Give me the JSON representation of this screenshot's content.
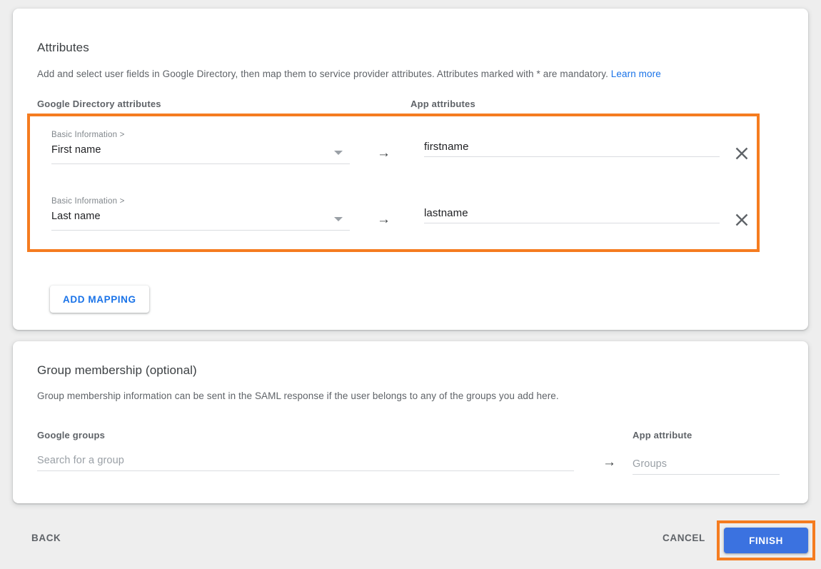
{
  "attributes_section": {
    "title": "Attributes",
    "description_before_link": "Add and select user fields in Google Directory, then map them to service provider attributes. Attributes marked with * are mandatory. ",
    "learn_more_label": "Learn more",
    "columns": {
      "google_directory": "Google Directory attributes",
      "app_attributes": "App attributes"
    },
    "mappings": [
      {
        "google_caption": "Basic Information >",
        "google_value": "First name",
        "arrow": "→",
        "app_value": "firstname",
        "app_placeholder": "",
        "remove_label": "×"
      },
      {
        "google_caption": "Basic Information >",
        "google_value": "Last name",
        "arrow": "→",
        "app_value": "lastname",
        "app_placeholder": "",
        "remove_label": "×"
      }
    ],
    "add_mapping_label": "ADD MAPPING"
  },
  "group_section": {
    "title": "Group membership (optional)",
    "description": "Group membership information can be sent in the SAML response if the user belongs to any of the groups you add here.",
    "google_groups_label": "Google groups",
    "google_groups_placeholder": "Search for a group",
    "google_groups_value": "",
    "arrow": "→",
    "app_attribute_label": "App attribute",
    "app_attribute_placeholder": "Groups",
    "app_attribute_value": ""
  },
  "footer": {
    "back_label": "BACK",
    "cancel_label": "CANCEL",
    "finish_label": "FINISH"
  },
  "colors": {
    "highlight_orange": "#f57c20",
    "primary_blue": "#3b72e0",
    "link_blue": "#1a73e8",
    "page_background": "#eeeeee",
    "card_background": "#ffffff",
    "text_primary": "#202124",
    "text_secondary": "#5f6368"
  }
}
